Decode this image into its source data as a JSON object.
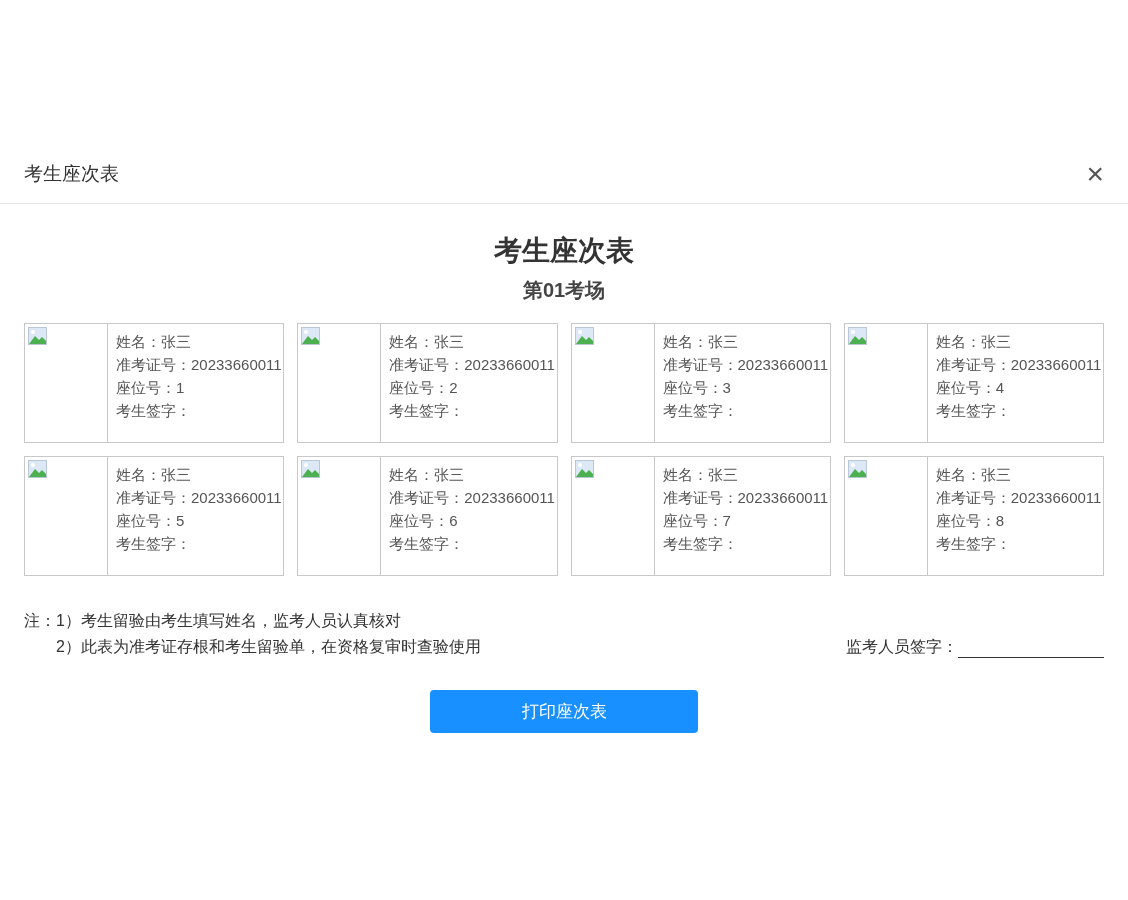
{
  "dialog": {
    "title": "考生座次表",
    "close": "×"
  },
  "sheet": {
    "title": "考生座次表",
    "subtitle": "第01考场"
  },
  "cards": [
    {
      "fields": [
        {
          "label": "姓名：",
          "value": "张三"
        },
        {
          "label": "准考证号：",
          "value": "20233660011"
        },
        {
          "label": "座位号：",
          "value": "1"
        },
        {
          "label": "考生签字："
        }
      ]
    },
    {
      "fields": [
        {
          "label": "姓名：",
          "value": "张三"
        },
        {
          "label": "准考证号：",
          "value": "20233660011"
        },
        {
          "label": "座位号：",
          "value": "2"
        },
        {
          "label": "考生签字："
        }
      ]
    },
    {
      "fields": [
        {
          "label": "姓名：",
          "value": "张三"
        },
        {
          "label": "准考证号：",
          "value": "20233660011"
        },
        {
          "label": "座位号：",
          "value": "3"
        },
        {
          "label": "考生签字："
        }
      ]
    },
    {
      "fields": [
        {
          "label": "姓名：",
          "value": "张三"
        },
        {
          "label": "准考证号：",
          "value": "20233660011"
        },
        {
          "label": "座位号：",
          "value": "4"
        },
        {
          "label": "考生签字："
        }
      ]
    },
    {
      "fields": [
        {
          "label": "姓名：",
          "value": "张三"
        },
        {
          "label": "准考证号：",
          "value": "20233660011"
        },
        {
          "label": "座位号：",
          "value": "5"
        },
        {
          "label": "考生签字："
        }
      ]
    },
    {
      "fields": [
        {
          "label": "姓名：",
          "value": "张三"
        },
        {
          "label": "准考证号：",
          "value": "20233660011"
        },
        {
          "label": "座位号：",
          "value": "6"
        },
        {
          "label": "考生签字："
        }
      ]
    },
    {
      "fields": [
        {
          "label": "姓名：",
          "value": "张三"
        },
        {
          "label": "准考证号：",
          "value": "20233660011"
        },
        {
          "label": "座位号：",
          "value": "7"
        },
        {
          "label": "考生签字："
        }
      ]
    },
    {
      "fields": [
        {
          "label": "姓名：",
          "value": "张三"
        },
        {
          "label": "准考证号：",
          "value": "20233660011"
        },
        {
          "label": "座位号：",
          "value": "8"
        },
        {
          "label": "考生签字："
        }
      ]
    }
  ],
  "notes": {
    "prefix": "注：",
    "items": [
      "1）考生留验由考生填写姓名，监考人员认真核对",
      "2）此表为准考证存根和考生留验单，在资格复审时查验使用"
    ]
  },
  "proctor_signature": {
    "label": "监考人员签字："
  },
  "print_button": "打印座次表"
}
